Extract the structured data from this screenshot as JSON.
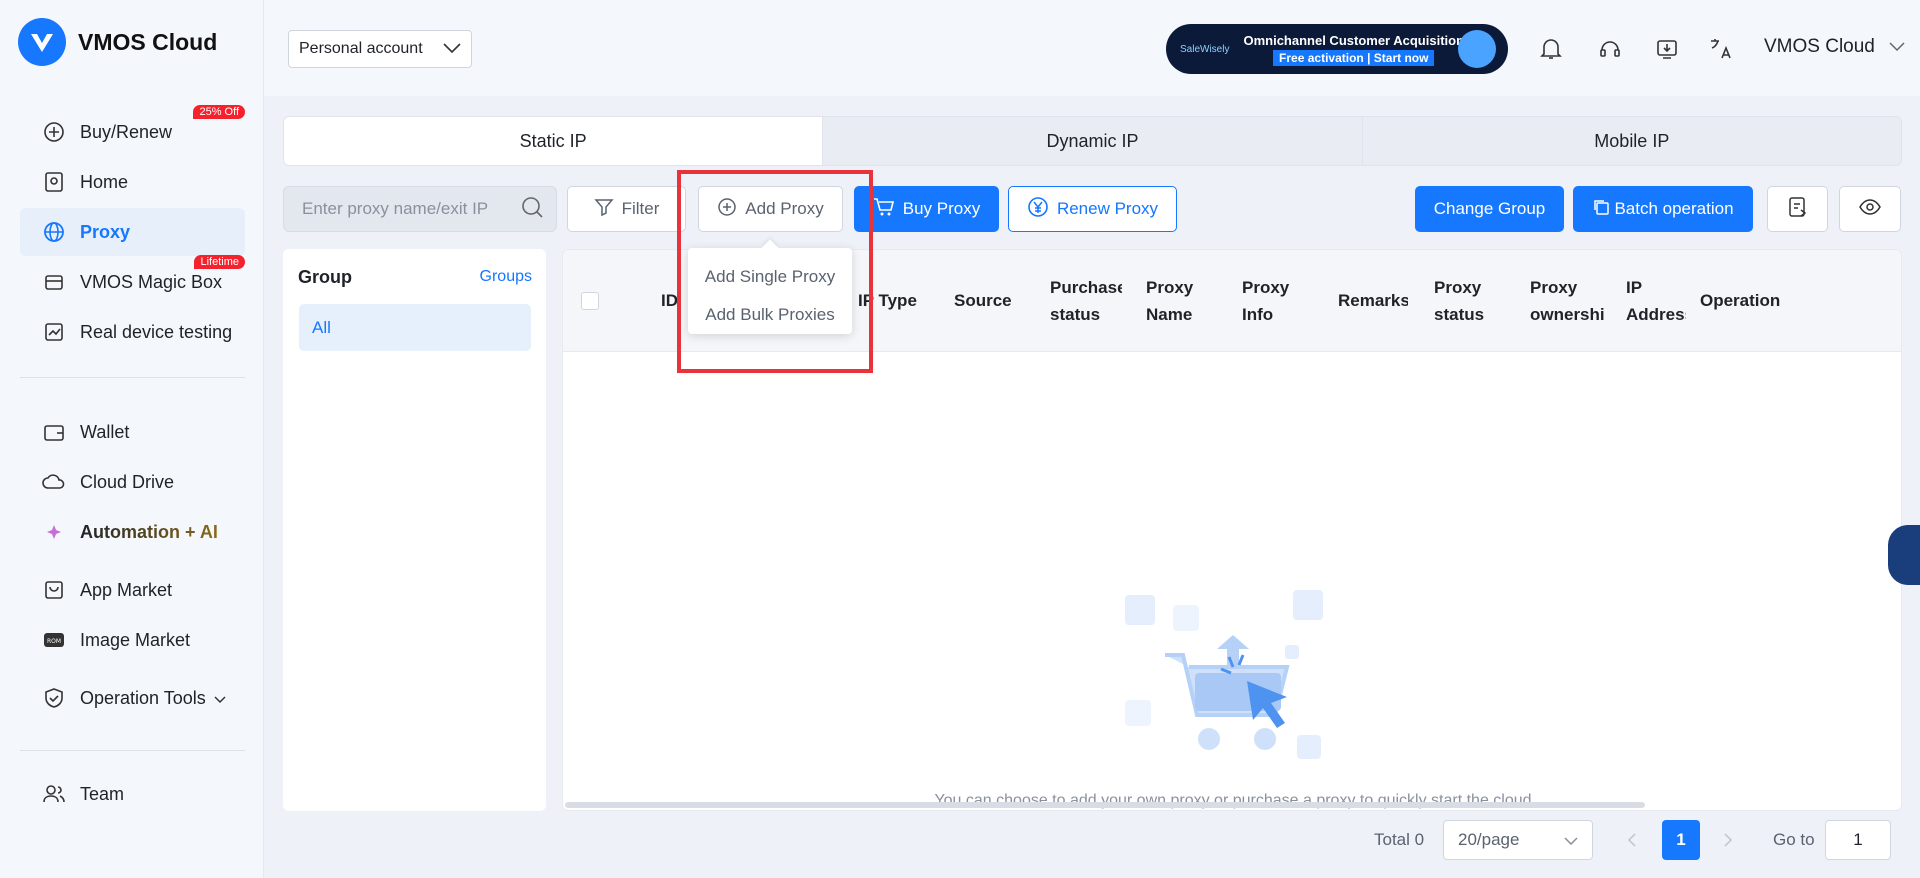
{
  "brand": {
    "name": "VMOS Cloud"
  },
  "sidebar": {
    "items": [
      {
        "label": "Buy/Renew",
        "icon": "plus-circle-icon",
        "badge": "25% Off"
      },
      {
        "label": "Home",
        "icon": "home-icon"
      },
      {
        "label": "Proxy",
        "icon": "globe-icon",
        "active": true
      },
      {
        "label": "VMOS Magic Box",
        "icon": "box-icon",
        "badge": "Lifetime"
      },
      {
        "label": "Real device testing",
        "icon": "chart-icon"
      },
      {
        "label": "Wallet",
        "icon": "wallet-icon"
      },
      {
        "label": "Cloud Drive",
        "icon": "cloud-icon"
      },
      {
        "label": "Automation + AI",
        "icon": "sparkle-icon"
      },
      {
        "label": "App Market",
        "icon": "app-market-icon"
      },
      {
        "label": "Image Market",
        "icon": "rom-icon"
      },
      {
        "label": "Operation Tools",
        "icon": "shield-icon"
      },
      {
        "label": "Team",
        "icon": "team-icon"
      }
    ]
  },
  "header": {
    "account_select": "Personal account",
    "banner": {
      "brand": "SaleWisely",
      "title": "Omnichannel Customer Acquisition",
      "subtitle": "Free activation | Start now"
    },
    "user": "VMOS Cloud"
  },
  "tabs": [
    "Static IP",
    "Dynamic IP",
    "Mobile IP"
  ],
  "toolbar": {
    "search_placeholder": "Enter proxy name/exit IP",
    "filter": "Filter",
    "add_proxy": "Add Proxy",
    "buy_proxy": "Buy Proxy",
    "renew_proxy": "Renew Proxy",
    "change_group": "Change Group",
    "batch_operation": "Batch operation"
  },
  "add_proxy_menu": [
    "Add Single Proxy",
    "Add Bulk Proxies"
  ],
  "groups": {
    "title": "Group",
    "link": "Groups",
    "all": "All"
  },
  "table": {
    "columns": [
      "ID",
      "IP Type",
      "Source",
      "Purchase status",
      "Proxy Name",
      "Proxy Info",
      "Remarks",
      "Proxy status",
      "Proxy ownership",
      "IP Address",
      "Operation"
    ],
    "empty_text": "You can choose to add your own proxy or purchase a proxy to quickly start the cloud"
  },
  "pagination": {
    "total": "Total 0",
    "page_size": "20/page",
    "current_page": "1",
    "goto_label": "Go to",
    "goto_value": "1"
  },
  "colors": {
    "primary": "#1677ff",
    "highlight": "#e8323c",
    "badge": "#f5222d"
  }
}
